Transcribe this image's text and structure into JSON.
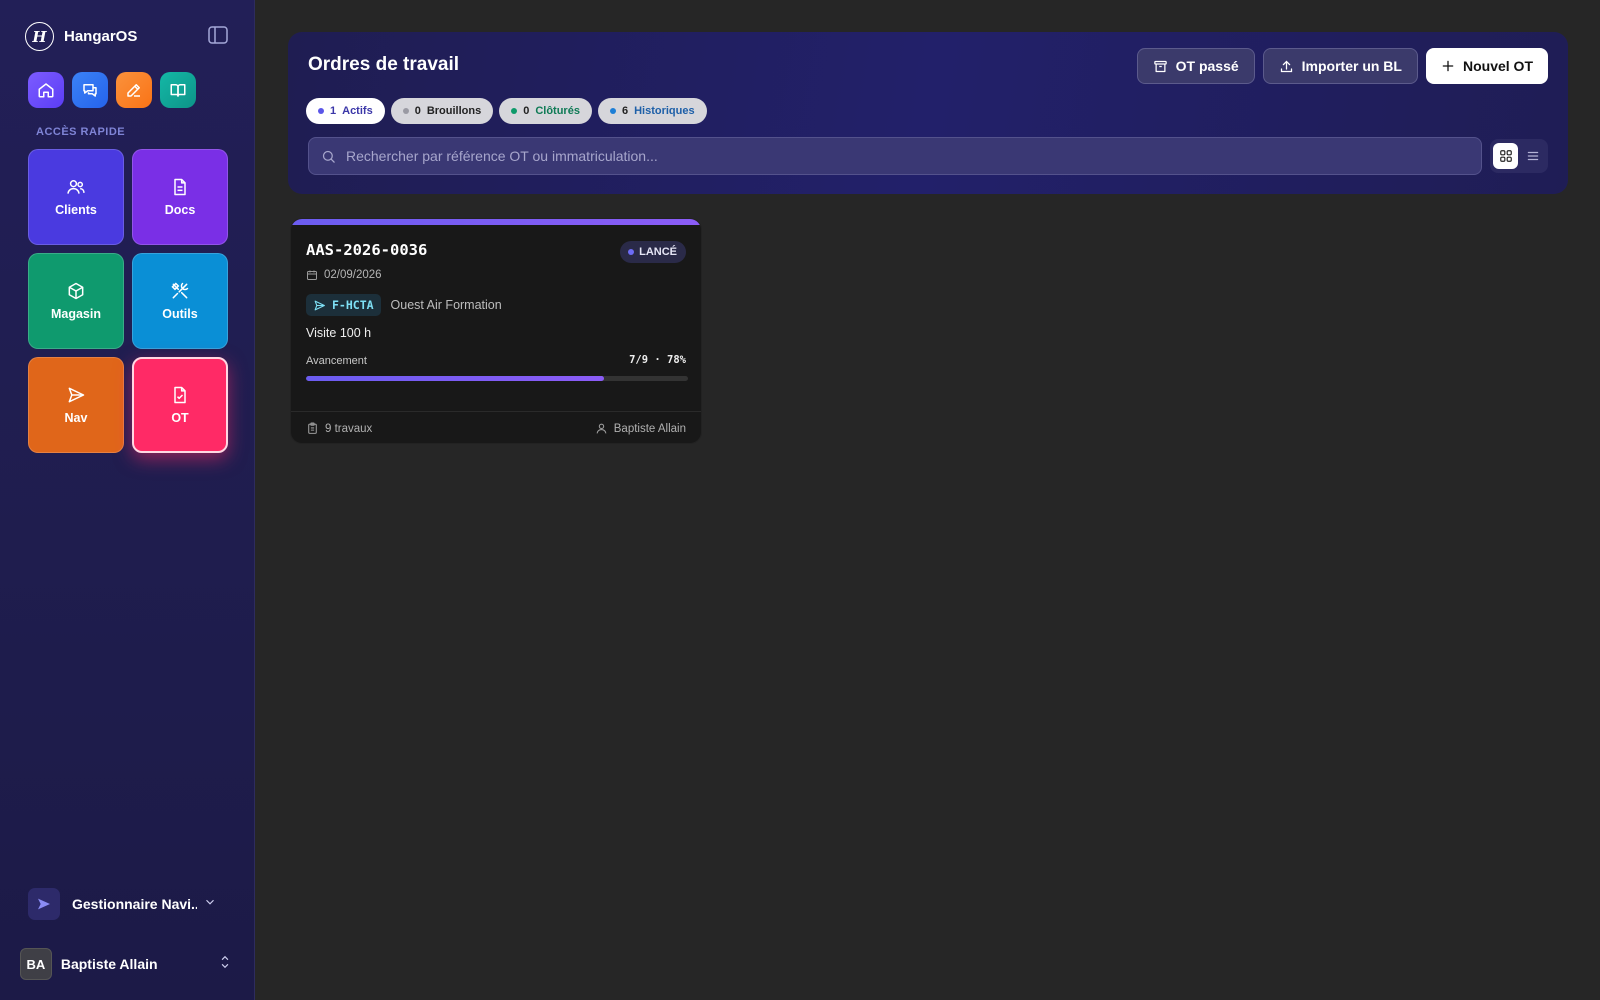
{
  "app": {
    "name": "HangarOS"
  },
  "sidebar": {
    "section_label": "ACCÈS RAPIDE",
    "quick_icons": [
      "home-icon",
      "chat-icon",
      "edit-icon",
      "book-icon"
    ],
    "tiles": [
      {
        "label": "Clients",
        "icon": "users-icon",
        "color": "#4a3ae0"
      },
      {
        "label": "Docs",
        "icon": "document-icon",
        "color": "#7a2fe6"
      },
      {
        "label": "Magasin",
        "icon": "box-icon",
        "color": "#0f9a6e"
      },
      {
        "label": "Outils",
        "icon": "tools-icon",
        "color": "#0a8fd6"
      },
      {
        "label": "Nav",
        "icon": "send-icon",
        "color": "#e0661a"
      },
      {
        "label": "OT",
        "icon": "file-check-icon",
        "color": "#ff2a66"
      }
    ],
    "org": {
      "name": "Gestionnaire Navi..."
    },
    "user": {
      "initials": "BA",
      "name": "Baptiste Allain"
    }
  },
  "header": {
    "title": "Ordres de travail",
    "actions": {
      "past": "OT passé",
      "import": "Importer un BL",
      "new": "Nouvel OT"
    },
    "tabs": [
      {
        "count": "1",
        "label": "Actifs"
      },
      {
        "count": "0",
        "label": "Brouillons"
      },
      {
        "count": "0",
        "label": "Clôturés"
      },
      {
        "count": "6",
        "label": "Historiques"
      }
    ],
    "search": {
      "placeholder": "Rechercher par référence OT ou immatriculation...",
      "value": ""
    }
  },
  "work_orders": [
    {
      "ref": "AAS-2026-0036",
      "status": "LANCÉ",
      "date": "02/09/2026",
      "registration": "F-HCTA",
      "client": "Ouest Air Formation",
      "title": "Visite 100 h",
      "progress_label": "Avancement",
      "progress_text": "7/9 · 78%",
      "progress_fraction": 0.78,
      "tasks": "9 travaux",
      "assignee": "Baptiste Allain"
    }
  ],
  "colors": {
    "accent": "#6b5cf0",
    "sidebar": "#221f57",
    "background": "#262626"
  }
}
